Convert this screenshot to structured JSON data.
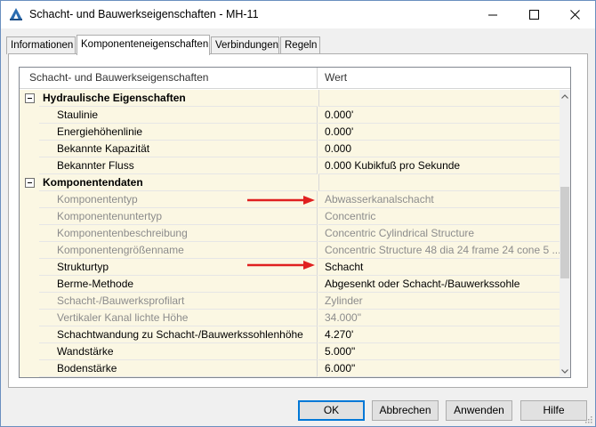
{
  "window": {
    "title": "Schacht- und Bauwerkseigenschaften - MH-11"
  },
  "tabs": [
    {
      "label": "Informationen"
    },
    {
      "label": "Komponenteneigenschaften"
    },
    {
      "label": "Verbindungen"
    },
    {
      "label": "Regeln"
    }
  ],
  "grid": {
    "header_property": "Schacht- und Bauwerkseigenschaften",
    "header_value": "Wert",
    "rows": [
      {
        "type": "group",
        "name": "Hydraulische Eigenschaften",
        "value": ""
      },
      {
        "type": "prop",
        "name": "Staulinie",
        "value": "0.000'",
        "disabled": false
      },
      {
        "type": "prop",
        "name": "Energiehöhenlinie",
        "value": "0.000'",
        "disabled": false
      },
      {
        "type": "prop",
        "name": "Bekannte Kapazität",
        "value": "0.000",
        "disabled": false
      },
      {
        "type": "prop",
        "name": "Bekannter Fluss",
        "value": "0.000 Kubikfuß pro Sekunde",
        "disabled": false
      },
      {
        "type": "group",
        "name": "Komponentendaten",
        "value": ""
      },
      {
        "type": "prop",
        "name": "Komponententyp",
        "value": "Abwasserkanalschacht",
        "disabled": true
      },
      {
        "type": "prop",
        "name": "Komponentenuntertyp",
        "value": "Concentric",
        "disabled": true
      },
      {
        "type": "prop",
        "name": "Komponentenbeschreibung",
        "value": "Concentric Cylindrical Structure",
        "disabled": true
      },
      {
        "type": "prop",
        "name": "Komponentengrößenname",
        "value": "Concentric Structure 48 dia 24 frame 24 cone 5 ...",
        "disabled": true
      },
      {
        "type": "prop",
        "name": "Strukturtyp",
        "value": "Schacht",
        "disabled": false
      },
      {
        "type": "prop",
        "name": "Berme-Methode",
        "value": "Abgesenkt oder Schacht-/Bauwerkssohle",
        "disabled": false
      },
      {
        "type": "prop",
        "name": "Schacht-/Bauwerksprofilart",
        "value": "Zylinder",
        "disabled": true
      },
      {
        "type": "prop",
        "name": "Vertikaler Kanal lichte Höhe",
        "value": "34.000\"",
        "disabled": true
      },
      {
        "type": "prop",
        "name": "Schachtwandung zu Schacht-/Bauwerkssohlenhöhe",
        "value": "4.270'",
        "disabled": false
      },
      {
        "type": "prop",
        "name": "Wandstärke",
        "value": "5.000\"",
        "disabled": false
      },
      {
        "type": "prop",
        "name": "Bodenstärke",
        "value": "6.000\"",
        "disabled": false
      }
    ]
  },
  "buttons": {
    "ok": "OK",
    "cancel": "Abbrechen",
    "apply": "Anwenden",
    "help": "Hilfe"
  },
  "icons": {
    "app": "civil3d-app-icon",
    "minimize": "minimize-icon",
    "maximize": "maximize-icon",
    "close": "close-icon",
    "annotation_arrow": "red-arrow-icon"
  },
  "colors": {
    "row_background": "#fbf7e3",
    "disabled_text": "#8c8c8c",
    "arrow": "#e02020",
    "default_button_border": "#0078d7"
  }
}
